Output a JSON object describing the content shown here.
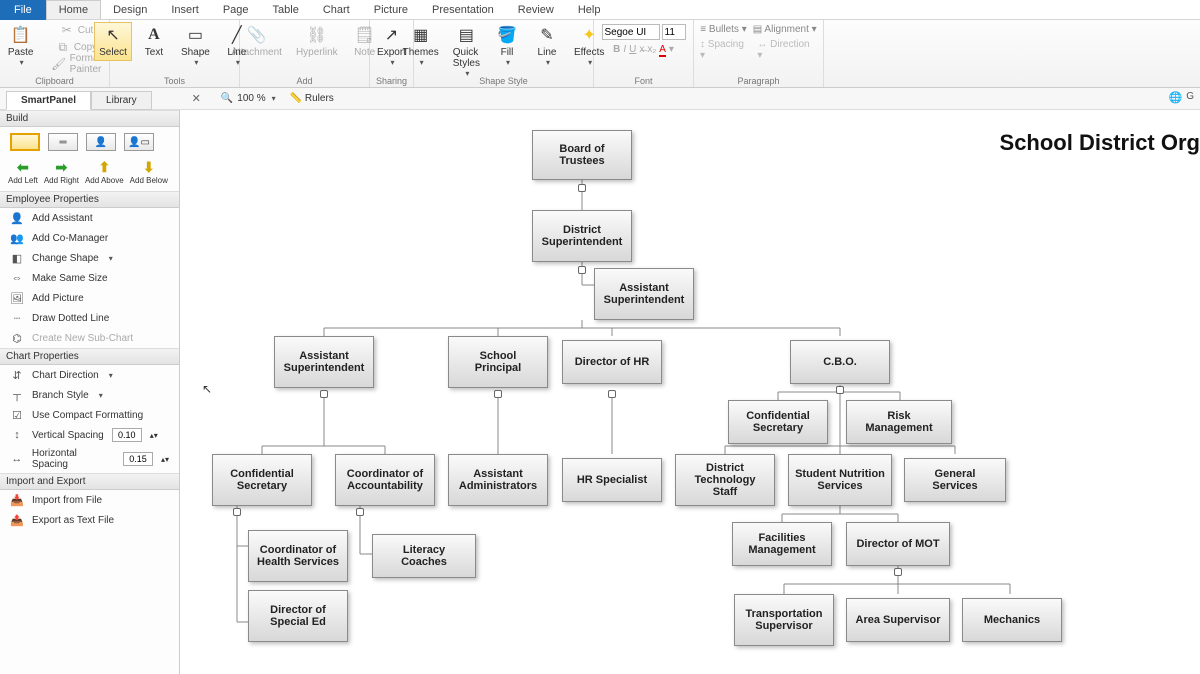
{
  "menu": {
    "file": "File",
    "tabs": [
      "Home",
      "Design",
      "Insert",
      "Page",
      "Table",
      "Chart",
      "Picture",
      "Presentation",
      "Review",
      "Help"
    ],
    "active": "Home"
  },
  "ribbon": {
    "clipboard": {
      "paste": "Paste",
      "cut": "Cut",
      "copy": "Copy",
      "format_painter": "Format Painter",
      "label": "Clipboard"
    },
    "tools": {
      "select": "Select",
      "text": "Text",
      "shape": "Shape",
      "line": "Line",
      "label": "Tools"
    },
    "add": {
      "attachment": "Attachment",
      "hyperlink": "Hyperlink",
      "note": "Note",
      "label": "Add"
    },
    "sharing": {
      "export": "Export",
      "label": "Sharing"
    },
    "shape_style": {
      "themes": "Themes",
      "quick_styles": "Quick\nStyles",
      "fill": "Fill",
      "line": "Line",
      "effects": "Effects",
      "label": "Shape Style"
    },
    "font": {
      "name": "Segoe UI",
      "size": "11",
      "label": "Font"
    },
    "paragraph": {
      "bullets": "Bullets",
      "alignment": "Alignment",
      "spacing": "Spacing",
      "direction": "Direction",
      "label": "Paragraph"
    }
  },
  "panel_tabs": {
    "smart": "SmartPanel",
    "library": "Library"
  },
  "zoom": {
    "value": "100 %",
    "rulers": "Rulers"
  },
  "side": {
    "build": "Build",
    "add_left": "Add Left",
    "add_right": "Add Right",
    "add_above": "Add Above",
    "add_below": "Add Below",
    "emp_header": "Employee Properties",
    "add_assistant": "Add Assistant",
    "add_comanager": "Add Co-Manager",
    "change_shape": "Change Shape",
    "make_same": "Make Same Size",
    "add_picture": "Add Picture",
    "draw_dotted": "Draw Dotted Line",
    "create_sub": "Create New Sub-Chart",
    "chart_header": "Chart Properties",
    "chart_direction": "Chart Direction",
    "branch_style": "Branch Style",
    "compact": "Use Compact Formatting",
    "vspacing": "Vertical Spacing",
    "vspacing_val": "0.10",
    "hspacing": "Horizontal Spacing",
    "hspacing_val": "0.15",
    "import_header": "Import and Export",
    "import_file": "Import from File",
    "export_text": "Export as Text File"
  },
  "chart": {
    "title": "School District Org ",
    "nodes": {
      "board": "Board of Trustees",
      "dist_super": "District\nSuperintendent",
      "asst_super_top": "Assistant\nSuperintendent",
      "asst_super_left": "Assistant\nSuperintendent",
      "principal": "School\nPrincipal",
      "dir_hr": "Director of HR",
      "cbo": "C.B.O.",
      "conf_sec_r": "Confidential\nSecretary",
      "risk": "Risk Management",
      "conf_sec_l": "Confidential\nSecretary",
      "coord_acct": "Coordinator of\nAccountability",
      "asst_admin": "Assistant\nAdministrators",
      "hr_spec": "HR Specialist",
      "dist_tech": "District\nTechnology Staff",
      "nutrition": "Student Nutrition\nServices",
      "general": "General Services",
      "coord_health": "Coordinator of\nHealth Services",
      "literacy": "Literacy Coaches",
      "facilities": "Facilities\nManagement",
      "dir_mot": "Director of MOT",
      "transport": "Transportation\nSupervisor",
      "area_sup": "Area Supervisor",
      "mechanics": "Mechanics",
      "dir_special": "Director of\nSpecial Ed"
    }
  }
}
